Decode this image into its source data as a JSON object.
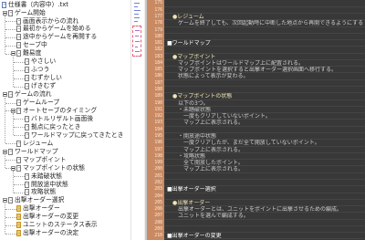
{
  "tree": {
    "items": [
      {
        "label": "仕様書（内容中）.txt",
        "level": 0,
        "toggle": false,
        "icon": "document-root-icon"
      },
      {
        "label": "ゲーム開始",
        "level": 1,
        "toggle": true,
        "icon": "page-icon"
      },
      {
        "label": "画面表示からの流れ",
        "level": 2,
        "toggle": false,
        "icon": "page-icon"
      },
      {
        "label": "最初からゲームを始める",
        "level": 2,
        "toggle": false,
        "icon": "page-icon"
      },
      {
        "label": "途中からゲームを再開する",
        "level": 2,
        "toggle": false,
        "icon": "page-icon"
      },
      {
        "label": "セーブ中",
        "level": 2,
        "toggle": false,
        "icon": "page-icon"
      },
      {
        "label": "難易度",
        "level": 2,
        "toggle": true,
        "icon": "page-icon"
      },
      {
        "label": "やさしい",
        "level": 3,
        "toggle": false,
        "icon": "page-icon"
      },
      {
        "label": "ふつう",
        "level": 3,
        "toggle": false,
        "icon": "page-icon"
      },
      {
        "label": "むずかしい",
        "level": 3,
        "toggle": false,
        "icon": "page-icon"
      },
      {
        "label": "げきむず",
        "level": 3,
        "toggle": false,
        "icon": "page-icon"
      },
      {
        "label": "ゲームの流れ",
        "level": 1,
        "toggle": true,
        "icon": "page-icon"
      },
      {
        "label": "ゲームループ",
        "level": 2,
        "toggle": false,
        "icon": "page-icon"
      },
      {
        "label": "オートセーブのタイミング",
        "level": 2,
        "toggle": true,
        "icon": "page-icon"
      },
      {
        "label": "バトルリザルト画面後",
        "level": 3,
        "toggle": false,
        "icon": "page-icon"
      },
      {
        "label": "拠点に戻ったとき",
        "level": 3,
        "toggle": false,
        "icon": "page-icon"
      },
      {
        "label": "ワールドマップに戻ってきたとき",
        "level": 3,
        "toggle": false,
        "icon": "page-icon"
      },
      {
        "label": "レジューム",
        "level": 2,
        "toggle": false,
        "icon": "page-icon"
      },
      {
        "label": "ワールドマップ",
        "level": 1,
        "toggle": true,
        "icon": "page-icon"
      },
      {
        "label": "マップポイント",
        "level": 2,
        "toggle": false,
        "icon": "page-icon"
      },
      {
        "label": "マップポイントの状態",
        "level": 2,
        "toggle": true,
        "icon": "page-icon"
      },
      {
        "label": "未踏破状態",
        "level": 3,
        "toggle": false,
        "icon": "page-icon"
      },
      {
        "label": "開放途中状態",
        "level": 3,
        "toggle": false,
        "icon": "page-icon"
      },
      {
        "label": "攻略状態",
        "level": 3,
        "toggle": false,
        "icon": "page-icon"
      },
      {
        "label": "出撃オーダー選択",
        "level": 1,
        "toggle": true,
        "icon": "page-icon"
      },
      {
        "label": "出撃オーダー",
        "level": 2,
        "toggle": false,
        "icon": "highlight-page-icon"
      },
      {
        "label": "出撃オーダーの変更",
        "level": 2,
        "toggle": false,
        "icon": "highlight-page-icon"
      },
      {
        "label": "ユニットのステータス表示",
        "level": 2,
        "toggle": false,
        "icon": "highlight-page-icon"
      },
      {
        "label": "出撃オーダーの決定",
        "level": 2,
        "toggle": false,
        "icon": "highlight-page-icon"
      }
    ]
  },
  "editor": {
    "lines": [
      {
        "no": "175",
        "text": ""
      },
      {
        "no": "176",
        "text": ""
      },
      {
        "no": "177",
        "text": "　●レジューム"
      },
      {
        "no": "178",
        "text": "　　ゲームを終了しても、次回起動時に中断した地点から再開できるようにする。（仕様変更）"
      },
      {
        "no": "179",
        "text": ""
      },
      {
        "no": "180",
        "text": ""
      },
      {
        "no": "181",
        "text": "■ワールドマップ"
      },
      {
        "no": "182",
        "text": ""
      },
      {
        "no": "183",
        "text": "　●マップポイント"
      },
      {
        "no": "184",
        "text": "　　マップポイントはワールドマップ上に配置される。"
      },
      {
        "no": "185",
        "text": "　　マップポイントを選択すると出撃オーダー選択画面へ移行する。"
      },
      {
        "no": "186",
        "text": "　　状態によって表示が変わる。"
      },
      {
        "no": "187",
        "text": ""
      },
      {
        "no": "188",
        "text": ""
      },
      {
        "no": "189",
        "text": "　●マップポイントの状態"
      },
      {
        "no": "190",
        "text": "　　以下の3つ。"
      },
      {
        "no": "191",
        "text": "　　・未踏破状態"
      },
      {
        "no": "192",
        "text": "　　　一度もクリアしていないポイント。"
      },
      {
        "no": "193",
        "text": "　　　マップ上に表示される。"
      },
      {
        "no": "194",
        "text": ""
      },
      {
        "no": "195",
        "text": "　　・開放途中状態"
      },
      {
        "no": "196",
        "text": "　　　一度クリアしたが、まだ全て開放していないポイント。"
      },
      {
        "no": "197",
        "text": "　　　マップ上に表示される。"
      },
      {
        "no": "198",
        "text": "　　・攻略状態"
      },
      {
        "no": "199",
        "text": "　　　全て開放したポイント。"
      },
      {
        "no": "200",
        "text": "　　　マップ上に表示される。"
      },
      {
        "no": "201",
        "text": ""
      },
      {
        "no": "202",
        "text": ""
      },
      {
        "no": "203",
        "text": "■出撃オーダー選択"
      },
      {
        "no": "204",
        "text": ""
      },
      {
        "no": "205",
        "text": "　●出撃オーダー"
      },
      {
        "no": "206",
        "text": "　　出撃オーダーとは、ユニットをポイントに出撃させるための編成。"
      },
      {
        "no": "207",
        "text": "　　ユニットを選んで編成する。"
      },
      {
        "no": "208",
        "text": ""
      },
      {
        "no": "209",
        "text": ""
      },
      {
        "no": "210",
        "text": "■出撃オーダーの変更"
      }
    ]
  },
  "colors": {
    "tree_bg": "#ffffff",
    "editor_bg": "#383838",
    "gutter_bg": "#c98a63",
    "editor_text": "#cfcfcf",
    "heading_text": "#ffffff",
    "subheading_text": "#efe4b6",
    "highlight_icon": "#f2c94c"
  }
}
